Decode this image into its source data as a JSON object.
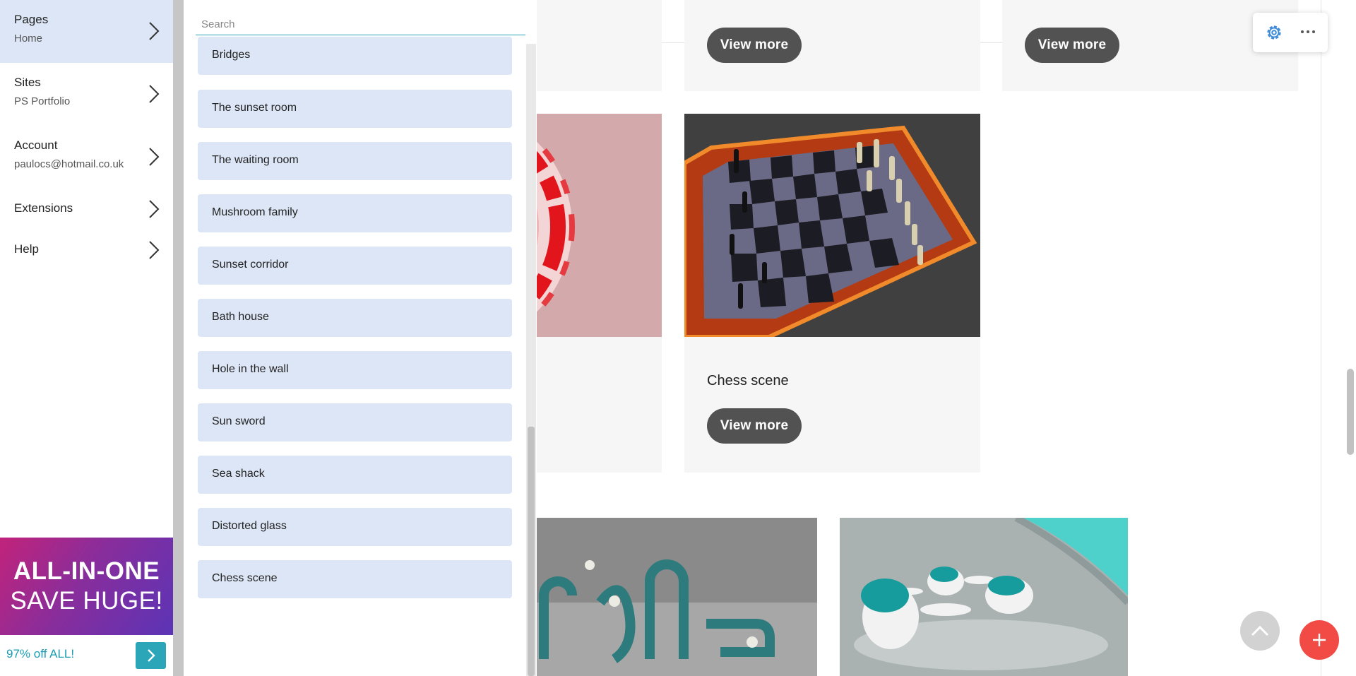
{
  "nav": {
    "items": [
      {
        "title": "Pages",
        "subtitle": "Home"
      },
      {
        "title": "Sites",
        "subtitle": "PS Portfolio"
      },
      {
        "title": "Account",
        "subtitle": "paulocs@hotmail.co.uk"
      },
      {
        "title": "Extensions",
        "subtitle": ""
      },
      {
        "title": "Help",
        "subtitle": ""
      }
    ],
    "promo": {
      "line1": "ALL-IN-ONE",
      "line2": "SAVE HUGE!",
      "offer": "97% off ALL!"
    }
  },
  "pages_panel": {
    "search_placeholder": "Search",
    "items": [
      "Bridges",
      "The sunset room",
      "The waiting room",
      "Mushroom family",
      "Sunset corridor",
      "Bath house",
      "Hole in the wall",
      "Sun sword",
      "Sea shack",
      "Distorted glass",
      "Chess scene"
    ]
  },
  "site": {
    "header_social": [
      "instagram-icon",
      "linkedin-icon"
    ],
    "cards": [
      {
        "title": "",
        "button": "View more"
      },
      {
        "title": "",
        "button": "View more"
      },
      {
        "title": "Chess scene",
        "button": "View more"
      }
    ],
    "in_logo": "i"
  },
  "colors": {
    "accent": "#2aa6b8",
    "nav_active": "#dde6f6",
    "add_button": "#f24a45",
    "view_button": "#525252"
  }
}
